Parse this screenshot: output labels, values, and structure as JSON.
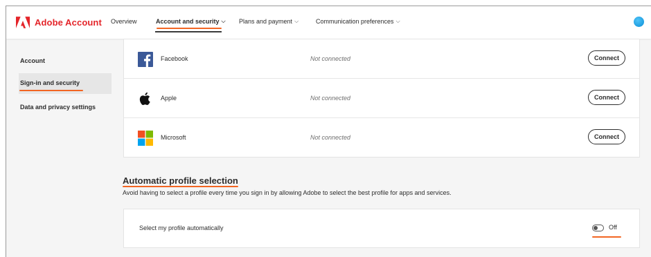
{
  "header": {
    "brand": "Adobe Account",
    "nav": [
      {
        "label": "Overview",
        "has_chevron": false,
        "active": false
      },
      {
        "label": "Account and security",
        "has_chevron": true,
        "active": true
      },
      {
        "label": "Plans and payment",
        "has_chevron": true,
        "active": false
      },
      {
        "label": "Communication preferences",
        "has_chevron": true,
        "active": false
      }
    ],
    "chevron_glyph": "⌵"
  },
  "sidebar": {
    "items": [
      {
        "label": "Account",
        "active": false
      },
      {
        "label": "Sign-in and security",
        "active": true
      },
      {
        "label": "Data and privacy settings",
        "active": false
      }
    ]
  },
  "social_connections": [
    {
      "name": "Facebook",
      "status": "Not connected",
      "action": "Connect",
      "icon": "facebook-icon"
    },
    {
      "name": "Apple",
      "status": "Not connected",
      "action": "Connect",
      "icon": "apple-icon"
    },
    {
      "name": "Microsoft",
      "status": "Not connected",
      "action": "Connect",
      "icon": "microsoft-icon"
    }
  ],
  "auto_profile": {
    "title": "Automatic profile selection",
    "description": "Avoid having to select a profile every time you sign in by allowing Adobe to select the best profile for apps and services.",
    "setting_label": "Select my profile automatically",
    "toggle_state": "Off"
  },
  "colors": {
    "brand_red": "#e4252a",
    "annotation_orange": "#f26522",
    "facebook_blue": "#3b5998",
    "avatar_blue": "#0a8fd8"
  }
}
